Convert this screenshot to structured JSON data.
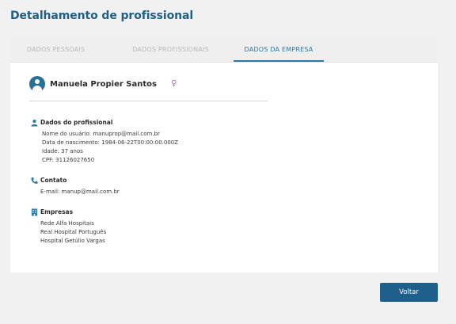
{
  "page": {
    "title": "Detalhamento de profissional"
  },
  "tabs": [
    {
      "label": "DADOS PESSOAIS",
      "active": false
    },
    {
      "label": "DADOS PROFISSIONAIS",
      "active": false
    },
    {
      "label": "DADOS DA EMPRESA",
      "active": true
    }
  ],
  "profile": {
    "name": "Manuela Propier Santos",
    "gender_icon": "♀"
  },
  "sections": {
    "professional": {
      "title": "Dados do profissional",
      "icon": "user-icon",
      "lines": [
        "Nome do usuário: manuprop@mail.com.br",
        "Data de nascimento: 1984-06-22T00:00:00.000Z",
        "Idade: 37 anos",
        "CPF: 31126027650"
      ]
    },
    "contact": {
      "title": "Contato",
      "icon": "phone-icon",
      "lines": [
        "E-mail: manup@mail.com.br"
      ]
    },
    "companies": {
      "title": "Empresas",
      "icon": "building-icon",
      "lines": [
        "Rede Alfa Hospitais",
        "Real Hospital Português",
        "Hospital Getúlio Vargas"
      ]
    }
  },
  "actions": {
    "back_label": "Voltar"
  },
  "colors": {
    "accent": "#2a7aa3",
    "title": "#1f5f82",
    "button": "#1f5f8b",
    "background": "#f1f1f2"
  }
}
